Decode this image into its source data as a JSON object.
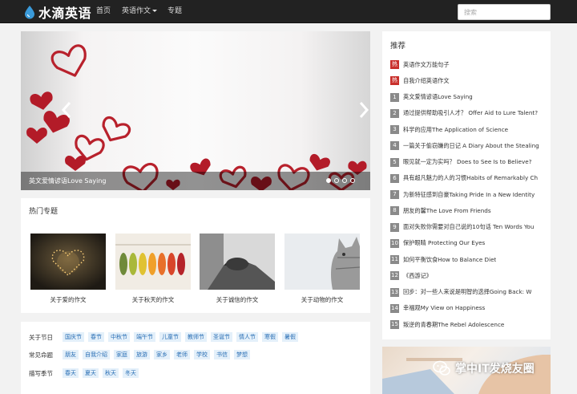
{
  "nav": {
    "brand": "水滴英语",
    "links": [
      "首页",
      "英语作文",
      "专题"
    ],
    "search_placeholder": "搜索"
  },
  "carousel": {
    "caption": "英文爱情谚语Love Saying",
    "dot_count": 4,
    "active_dot": 0
  },
  "hot_topics": {
    "title": "热门专题",
    "items": [
      {
        "label": "关于爱的作文",
        "icon": "heart-lights-image"
      },
      {
        "label": "关于秋天的作文",
        "icon": "autumn-leaves-image"
      },
      {
        "label": "关于诚信的作文",
        "icon": "handshake-image"
      },
      {
        "label": "关于动物的作文",
        "icon": "cat-image"
      }
    ]
  },
  "tags": {
    "rows": [
      {
        "head": "关于节日",
        "items": [
          "国庆节",
          "春节",
          "中秋节",
          "端午节",
          "儿童节",
          "教师节",
          "圣诞节",
          "情人节",
          "寒假",
          "暑假"
        ]
      },
      {
        "head": "常见命题",
        "items": [
          "朋友",
          "自我介绍",
          "家庭",
          "旅游",
          "家乡",
          "老师",
          "学校",
          "书信",
          "梦想"
        ]
      },
      {
        "head": "描写季节",
        "items": [
          "春天",
          "夏天",
          "秋天",
          "冬天"
        ]
      }
    ]
  },
  "recommend": {
    "title": "推荐",
    "items": [
      {
        "badge": "热",
        "hot": true,
        "text": "英语作文万能句子"
      },
      {
        "badge": "热",
        "hot": true,
        "text": "自我介绍英语作文"
      },
      {
        "badge": "1",
        "hot": false,
        "text": "英文爱情谚语Love Saying"
      },
      {
        "badge": "2",
        "hot": false,
        "text": "通过提供帮助吸引人才？ Offer Aid to Lure Talent?"
      },
      {
        "badge": "3",
        "hot": false,
        "text": "科学的应用The Application of Science"
      },
      {
        "badge": "4",
        "hot": false,
        "text": "一篇关于偷窃嫌的日记 A Diary About the Stealing"
      },
      {
        "badge": "5",
        "hot": false,
        "text": "眼见就一定为实吗？ Does to See Is to Believe?"
      },
      {
        "badge": "6",
        "hot": false,
        "text": "具有超凡魅力的人的习惯Habits of Remarkably Ch"
      },
      {
        "badge": "7",
        "hot": false,
        "text": "为新特征感到自豪Taking Pride In a New Identity"
      },
      {
        "badge": "8",
        "hot": false,
        "text": "朋友的馨The Love From Friends"
      },
      {
        "badge": "9",
        "hot": false,
        "text": "面对失败你需要对自己说的10句话 Ten Words You"
      },
      {
        "badge": "10",
        "hot": false,
        "text": "保护眼睛 Protecting Our Eyes"
      },
      {
        "badge": "11",
        "hot": false,
        "text": "如何平衡饮食How to Balance Diet"
      },
      {
        "badge": "12",
        "hot": false,
        "text": "《西游记》"
      },
      {
        "badge": "13",
        "hot": false,
        "text": "回步：对一些人来说是明智的选择Going Back: W"
      },
      {
        "badge": "14",
        "hot": false,
        "text": "幸福观My View on Happiness"
      },
      {
        "badge": "15",
        "hot": false,
        "text": "叛逆的青春期The Rebel Adolescence"
      }
    ]
  },
  "watermark": {
    "text": "掌中IT发烧友圈"
  }
}
